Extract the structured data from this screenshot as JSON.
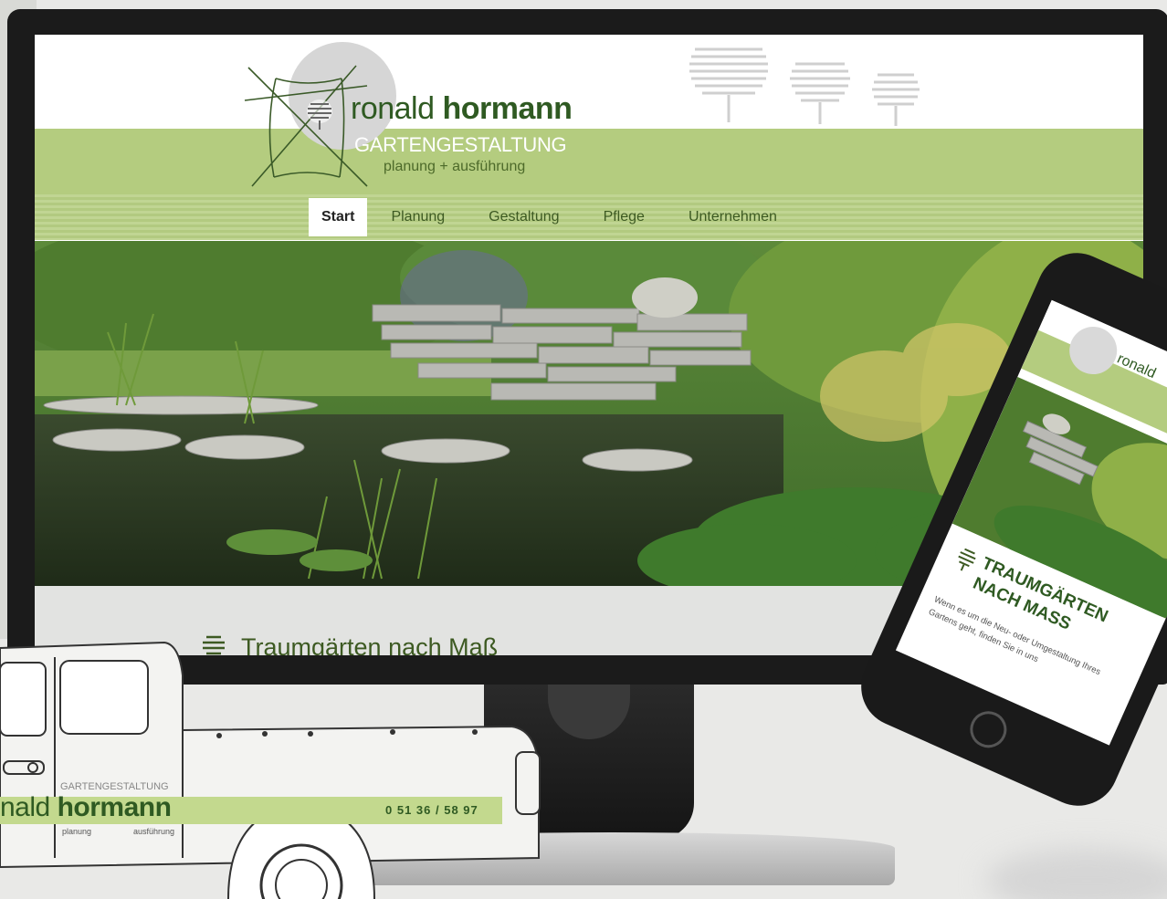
{
  "website": {
    "brand_first": "ronald",
    "brand_last": "hormann",
    "brand_sub": "GARTENGESTALTUNG",
    "brand_tag": "planung + ausführung",
    "nav": [
      {
        "label": "Start",
        "active": true
      },
      {
        "label": "Planung",
        "active": false
      },
      {
        "label": "Gestaltung",
        "active": false
      },
      {
        "label": "Pflege",
        "active": false
      },
      {
        "label": "Unternehmen",
        "active": false
      }
    ],
    "section_title": "Traumgärten nach Maß"
  },
  "phone": {
    "brand": "ronald",
    "title": "TRAUMGÄRTEN NACH MAß",
    "body": "Wenn es um die Neu- oder Umgestaltung Ihres Gartens geht, finden Sie in uns"
  },
  "truck": {
    "sub": "GARTENGESTALTUNG",
    "name_first": "nald",
    "name_last": "hormann",
    "phone": "0 51 36 / 58 97",
    "tag_left": "planung",
    "tag_right": "ausführung"
  },
  "colors": {
    "brand_green": "#b4cc7f",
    "dark_green": "#2f5a22",
    "logo_grey": "#d6d6d6"
  }
}
